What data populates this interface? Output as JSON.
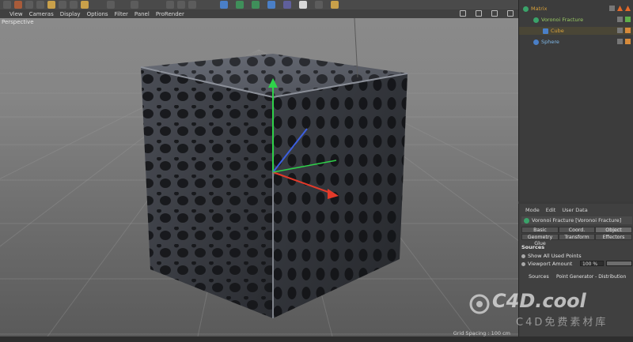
{
  "viewport_menu": [
    "View",
    "Cameras",
    "Display",
    "Options",
    "Filter",
    "Panel",
    "ProRender"
  ],
  "viewport": {
    "label": "Perspective",
    "grid_spacing": "Grid Spacing : 100 cm"
  },
  "objects": [
    {
      "name": "Matrix",
      "color": "#d9a13a",
      "icon": "matrix-icon"
    },
    {
      "name": "Voronoi Fracture",
      "color": "#9acb63",
      "icon": "voronoi-icon"
    },
    {
      "name": "Cube",
      "color": "#d9a13a",
      "icon": "cube-icon"
    },
    {
      "name": "Sphere",
      "color": "#7fb8e8",
      "icon": "sphere-icon"
    }
  ],
  "attributes": {
    "menu": [
      "Mode",
      "Edit",
      "User Data"
    ],
    "title": "Voronoi Fracture [Voronoi Fracture]",
    "tabs_row1": [
      "Basic",
      "Coord.",
      "Object"
    ],
    "tabs_row2": [
      "Geometry Glue",
      "Transform",
      "Effectors"
    ],
    "section": "Sources",
    "show_all_label": "Show All Used Points",
    "viewport_amount_label": "Viewport Amount",
    "viewport_amount_value": "100 %",
    "sources_label": "Sources",
    "sources_value": "Point Generator - Distribution"
  },
  "watermark": {
    "main": "C4D.cool",
    "sub": "C4D免费素材库"
  }
}
